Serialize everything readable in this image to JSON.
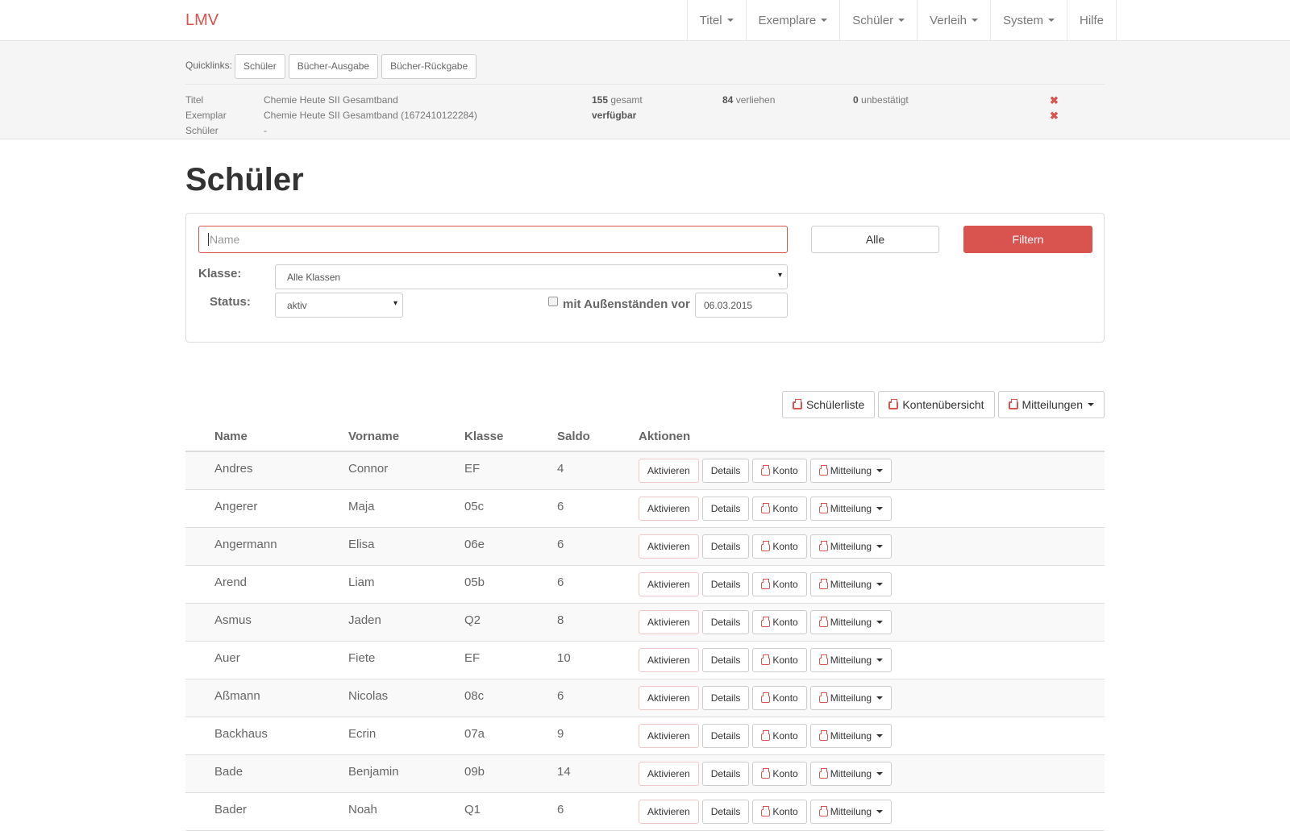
{
  "navbar": {
    "brand": "LMV",
    "items": [
      {
        "label": "Titel",
        "dropdown": true
      },
      {
        "label": "Exemplare",
        "dropdown": true
      },
      {
        "label": "Schüler",
        "dropdown": true
      },
      {
        "label": "Verleih",
        "dropdown": true
      },
      {
        "label": "System",
        "dropdown": true
      },
      {
        "label": "Hilfe",
        "dropdown": false
      }
    ]
  },
  "quicklinks": {
    "label": "Quicklinks:",
    "buttons": [
      "Schüler",
      "Bücher-Ausgabe",
      "Bücher-Rückgabe"
    ]
  },
  "info": {
    "titel_label": "Titel",
    "titel_value": "Chemie Heute SII Gesamtband",
    "gesamt_count": "155",
    "gesamt_text": "gesamt",
    "verliehen_count": "84",
    "verliehen_text": "verliehen",
    "unbestaetigt_count": "0",
    "unbestaetigt_text": "unbestätigt",
    "exemplar_label": "Exemplar",
    "exemplar_value": "Chemie Heute SII Gesamtband (1672410122284)",
    "exemplar_status": "verfügbar",
    "schueler_label": "Schüler",
    "schueler_value": "-",
    "remove_icon": "✖"
  },
  "page_title": "Schüler",
  "filter": {
    "name_placeholder": "Name",
    "alle_label": "Alle",
    "filtern_label": "Filtern",
    "klasse_label": "Klasse:",
    "klasse_value": "Alle Klassen",
    "status_label": "Status:",
    "status_value": "aktiv",
    "aussenstaende_label": "mit Außenständen vor",
    "date_value": "06.03.2015",
    "select_arrow": "▾"
  },
  "print_buttons": {
    "schuelerliste": "Schülerliste",
    "kontenuebersicht": "Kontenübersicht",
    "mitteilungen": "Mitteilungen"
  },
  "table": {
    "headers": {
      "name": "Name",
      "vorname": "Vorname",
      "klasse": "Klasse",
      "saldo": "Saldo",
      "aktionen": "Aktionen"
    },
    "action_labels": {
      "aktivieren": "Aktivieren",
      "details": "Details",
      "konto": "Konto",
      "mitteilung": "Mitteilung"
    },
    "rows": [
      {
        "name": "Andres",
        "vorname": "Connor",
        "klasse": "EF",
        "saldo": "4"
      },
      {
        "name": "Angerer",
        "vorname": "Maja",
        "klasse": "05c",
        "saldo": "6"
      },
      {
        "name": "Angermann",
        "vorname": "Elisa",
        "klasse": "06e",
        "saldo": "6"
      },
      {
        "name": "Arend",
        "vorname": "Liam",
        "klasse": "05b",
        "saldo": "6"
      },
      {
        "name": "Asmus",
        "vorname": "Jaden",
        "klasse": "Q2",
        "saldo": "8"
      },
      {
        "name": "Auer",
        "vorname": "Fiete",
        "klasse": "EF",
        "saldo": "10"
      },
      {
        "name": "Aßmann",
        "vorname": "Nicolas",
        "klasse": "08c",
        "saldo": "6"
      },
      {
        "name": "Backhaus",
        "vorname": "Ecrin",
        "klasse": "07a",
        "saldo": "9"
      },
      {
        "name": "Bade",
        "vorname": "Benjamin",
        "klasse": "09b",
        "saldo": "14"
      },
      {
        "name": "Bader",
        "vorname": "Noah",
        "klasse": "Q1",
        "saldo": "6"
      }
    ]
  },
  "colors": {
    "accent": "#d9534f"
  }
}
